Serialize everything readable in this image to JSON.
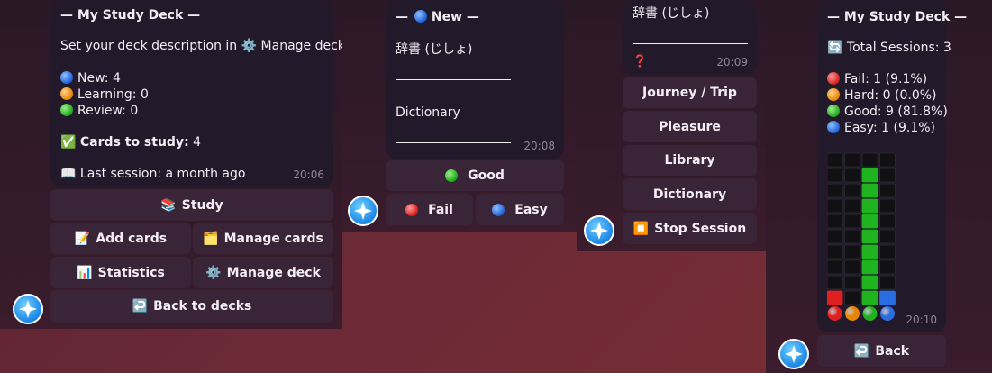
{
  "p1": {
    "title": "— My Study Deck —",
    "desc_prefix": "Set your deck description in",
    "desc_link": "Manage deck",
    "new": "New: 4",
    "learning": "Learning: 0",
    "review": "Review: 0",
    "cards_label": "Cards to study:",
    "cards_count": "4",
    "last_session": "Last session: a month ago",
    "time": "20:06",
    "buttons": {
      "study": "Study",
      "add_cards": "Add cards",
      "manage_cards": "Manage cards",
      "statistics": "Statistics",
      "manage_deck": "Manage deck",
      "back": "Back to decks"
    },
    "icons": {
      "study": "📚",
      "add_cards": "📝",
      "manage_cards": "🗂️",
      "statistics": "📊",
      "manage_deck": "⚙️",
      "back": "↩️",
      "gear": "⚙️",
      "check": "✅",
      "book": "📖"
    }
  },
  "p2": {
    "title_dash_left": "—",
    "title": "New",
    "title_dash_right": "—",
    "word": "辞書 (じしょ)",
    "answer": "Dictionary",
    "time": "20:08",
    "buttons": {
      "good": "Good",
      "fail": "Fail",
      "easy": "Easy"
    }
  },
  "p3": {
    "word": "辞書 (じしょ)",
    "mark": "❓",
    "time": "20:09",
    "buttons": {
      "journey": "Journey / Trip",
      "pleasure": "Pleasure",
      "library": "Library",
      "dictionary": "Dictionary",
      "stop": "Stop Session"
    },
    "icons": {
      "stop": "⏹️"
    }
  },
  "p4": {
    "title": "— My Study Deck —",
    "sessions": "Total Sessions: 3",
    "fail": "Fail: 1 (9.1%)",
    "hard": "Hard: 0 (0.0%)",
    "good": "Good: 9 (81.8%)",
    "easy": "Easy: 1 (9.1%)",
    "time": "20:10",
    "back": "Back",
    "icons": {
      "refresh": "🔄",
      "back": "↩️"
    },
    "chart_data": {
      "type": "bar",
      "categories": [
        "Fail",
        "Hard",
        "Good",
        "Easy"
      ],
      "values": [
        1,
        0,
        9,
        1
      ],
      "max_cells": 10,
      "colors": [
        "#e02020",
        "#e88400",
        "#1fb31f",
        "#2a6de0"
      ]
    }
  }
}
